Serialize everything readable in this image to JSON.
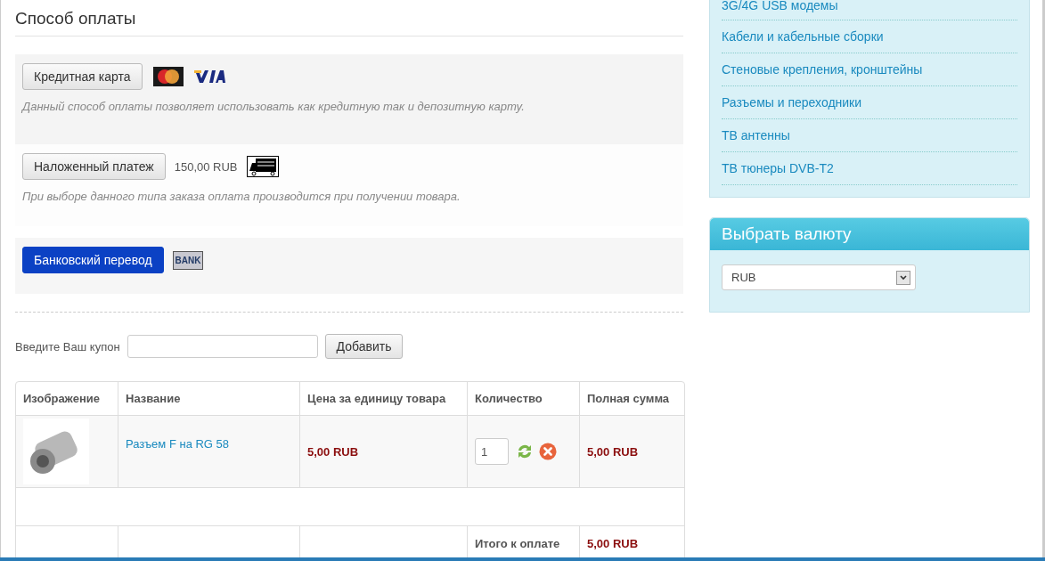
{
  "payment": {
    "title": "Способ оплаты",
    "methods": [
      {
        "kind": "cards",
        "label": "Кредитная карта",
        "selected": false,
        "description": "Данный способ оплаты позволяет использовать как кредитную так и депозитную карту."
      },
      {
        "kind": "cod",
        "label": "Наложенный платеж",
        "selected": false,
        "price": "150,00 RUB",
        "description": "При выборе данного типа заказа оплата производится при получении товара."
      },
      {
        "kind": "bank",
        "label": "Банковский перевод",
        "selected": true,
        "badge": "BANK"
      }
    ]
  },
  "coupon": {
    "label": "Введите Ваш купон",
    "button": "Добавить"
  },
  "cart": {
    "columns": [
      "Изображение",
      "Название",
      "Цена за единицу товара",
      "Количество",
      "Полная сумма"
    ],
    "rows": [
      {
        "name": "Разъем F на RG 58",
        "price": "5,00 RUB",
        "quantity": "1",
        "total": "5,00 RUB"
      }
    ],
    "total_label": "Итого к оплате",
    "total": "5,00 RUB"
  },
  "sidebar": {
    "categories": [
      "3G/4G USB модемы",
      "Кабели и кабельные сборки",
      "Стеновые крепления, кронштейны",
      "Разъемы и переходники",
      "ТВ антенны",
      "ТВ тюнеры DVB-T2"
    ],
    "currency": {
      "title": "Выбрать валюту",
      "value": "RUB"
    }
  }
}
